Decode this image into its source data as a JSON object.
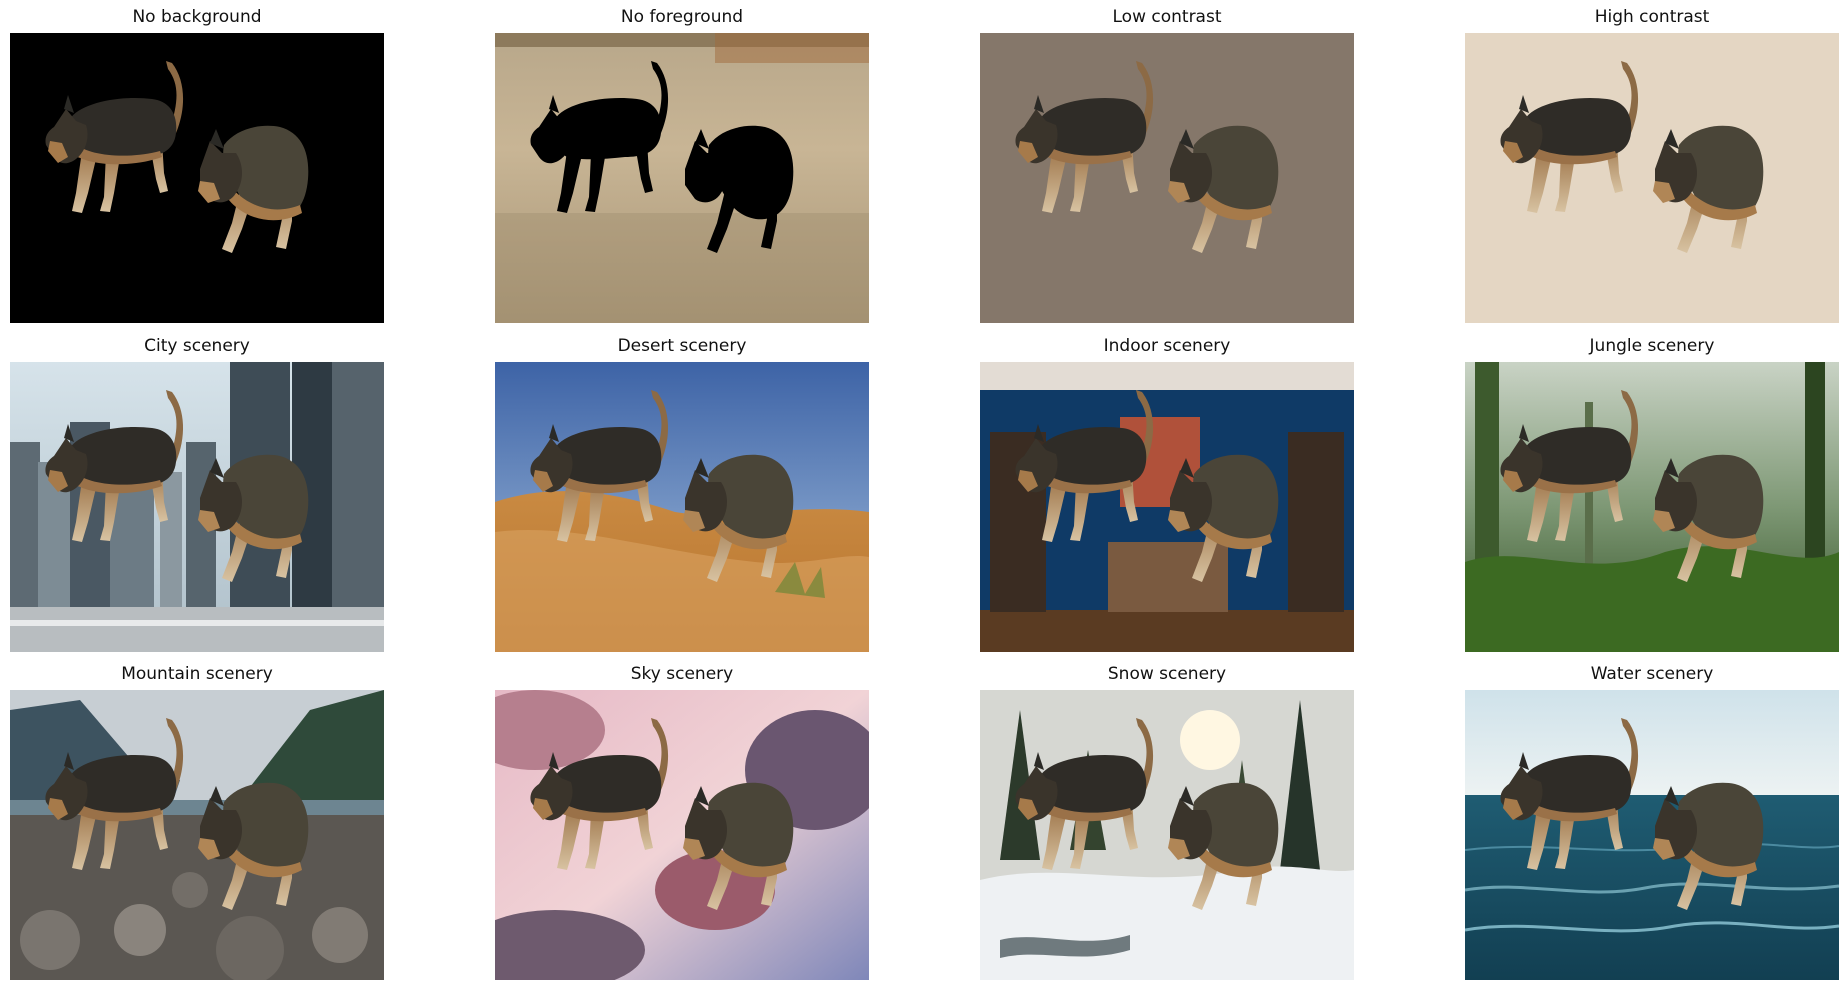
{
  "figure": {
    "panels": [
      {
        "title": "No background",
        "background": "black",
        "foreground": "two German Shepherd dogs"
      },
      {
        "title": "No foreground",
        "background": "dry dirt field",
        "foreground": "black dog silhouettes"
      },
      {
        "title": "Low contrast",
        "background": "flat brown-gray",
        "foreground": "two German Shepherd dogs"
      },
      {
        "title": "High contrast",
        "background": "flat beige",
        "foreground": "two German Shepherd dogs"
      },
      {
        "title": "City scenery",
        "background": "city street with skyscrapers",
        "foreground": "two German Shepherd dogs"
      },
      {
        "title": "Desert scenery",
        "background": "sand dunes under blue sky",
        "foreground": "two German Shepherd dogs"
      },
      {
        "title": "Indoor scenery",
        "background": "room with blue walls, bookshelves and dresser",
        "foreground": "two German Shepherd dogs"
      },
      {
        "title": "Jungle scenery",
        "background": "misty green jungle",
        "foreground": "two German Shepherd dogs"
      },
      {
        "title": "Mountain scenery",
        "background": "rocky shore with mountains",
        "foreground": "two German Shepherd dogs"
      },
      {
        "title": "Sky scenery",
        "background": "pink and purple clouds",
        "foreground": "two German Shepherd dogs"
      },
      {
        "title": "Snow scenery",
        "background": "snowy forest",
        "foreground": "two German Shepherd dogs"
      },
      {
        "title": "Water scenery",
        "background": "ocean waves",
        "foreground": "two German Shepherd dogs"
      }
    ]
  },
  "colors": {
    "low_contrast_bg": "#85776a",
    "high_contrast_bg": "#e4d6c3",
    "dog_dark": "#2b2a26",
    "dog_tan": "#a67a4a"
  }
}
